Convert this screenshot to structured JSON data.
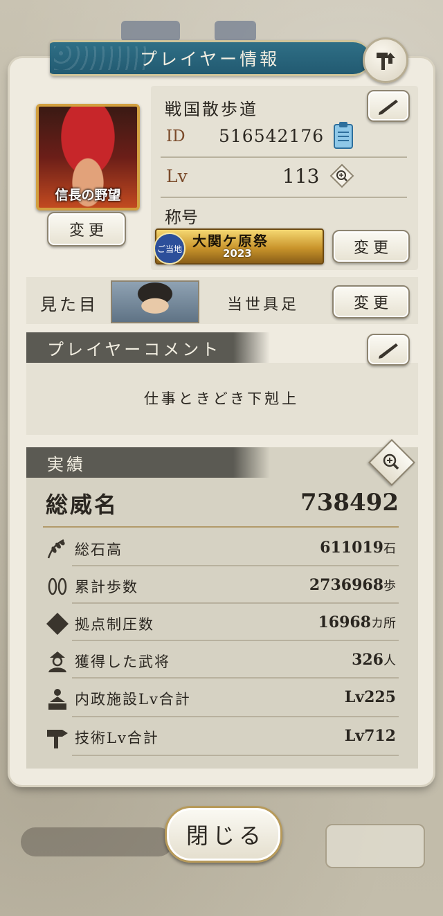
{
  "dialog": {
    "title": "プレイヤー情報",
    "close_label": "閉じる"
  },
  "profile": {
    "avatar_caption": "信長の野望",
    "change_avatar_label": "変更",
    "player_name": "戦国散歩道",
    "id_label": "ID",
    "id_value": "516542176",
    "lv_label": "Lv",
    "lv_value": "113",
    "title_label": "称号",
    "title_badge": {
      "circle_text": "ご当地",
      "main": "大関ケ原祭",
      "year": "2023"
    },
    "change_title_label": "変更"
  },
  "appearance": {
    "label": "見た目",
    "name": "当世具足",
    "change_label": "変更"
  },
  "comment": {
    "header": "プレイヤーコメント",
    "text": "仕事ときどき下剋上"
  },
  "achievements": {
    "header": "実績",
    "total_label": "総威名",
    "total_value": "738492",
    "rows": [
      {
        "icon": "rice-icon",
        "label": "総石高",
        "value": "611019",
        "unit": "石"
      },
      {
        "icon": "footprints-icon",
        "label": "累計歩数",
        "value": "2736968",
        "unit": "歩"
      },
      {
        "icon": "diamond-icon",
        "label": "拠点制圧数",
        "value": "16968",
        "unit": "カ所"
      },
      {
        "icon": "warlord-icon",
        "label": "獲得した武将",
        "value": "326",
        "unit": "人"
      },
      {
        "icon": "building-icon",
        "label": "内政施設Lv合計",
        "value": "Lv225",
        "unit": ""
      },
      {
        "icon": "hammer-icon",
        "label": "技術Lv合計",
        "value": "Lv712",
        "unit": ""
      }
    ]
  },
  "colors": {
    "title_bar": "#225a71",
    "section_header": "#5b5a53",
    "accent_brown": "#7a4a2a"
  }
}
